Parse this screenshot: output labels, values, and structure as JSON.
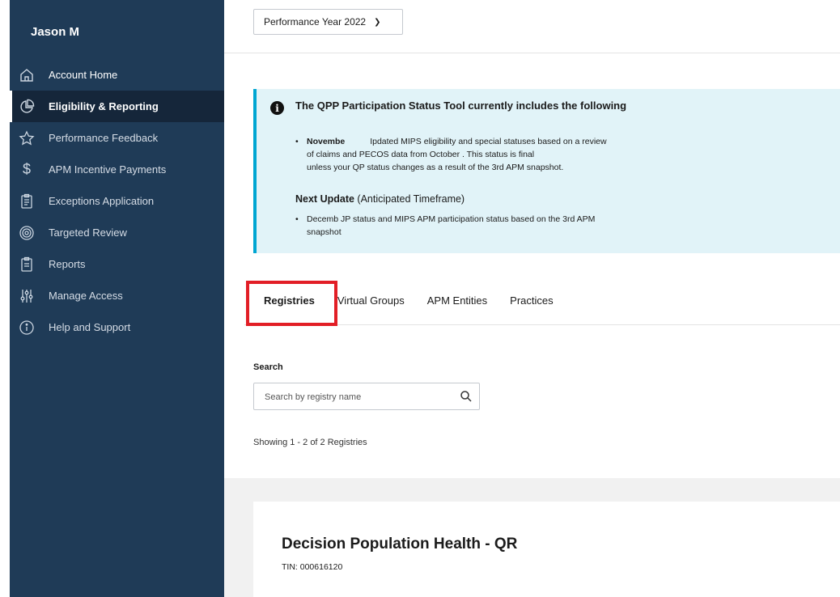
{
  "sidebar": {
    "user_name": "Jason M",
    "items": [
      {
        "label": "Account Home",
        "icon": "home-icon"
      },
      {
        "label": "Eligibility & Reporting",
        "icon": "pie-chart-icon"
      },
      {
        "label": "Performance Feedback",
        "icon": "star-icon"
      },
      {
        "label": "APM Incentive Payments",
        "icon": "dollar-icon"
      },
      {
        "label": "Exceptions Application",
        "icon": "clipboard-icon"
      },
      {
        "label": "Targeted Review",
        "icon": "target-icon"
      },
      {
        "label": "Reports",
        "icon": "clipboard-icon"
      },
      {
        "label": "Manage Access",
        "icon": "sliders-icon"
      },
      {
        "label": "Help and Support",
        "icon": "info-circle-icon"
      }
    ]
  },
  "header": {
    "performance_year": "Performance Year 2022"
  },
  "alert": {
    "title": "The QPP Participation Status Tool currently includes the following",
    "bullet1_bold": "Novembe",
    "bullet1_line1": "Ipdated MIPS eligibility and special statuses based on a review",
    "bullet1_line2": "of claims and PECOS data from October . This status is final",
    "bullet1_line3": "unless your QP status changes as a result of the 3rd APM snapshot.",
    "next_update_bold": "Next Update",
    "next_update_rest": " (Anticipated Timeframe)",
    "bullet2_line1": "Decemb JP status and MIPS APM participation status based on the 3rd APM",
    "bullet2_line2": "snapshot"
  },
  "tabs": [
    {
      "label": "Registries"
    },
    {
      "label": "Virtual Groups"
    },
    {
      "label": "APM Entities"
    },
    {
      "label": "Practices"
    }
  ],
  "search": {
    "label": "Search",
    "placeholder": "Search by registry name"
  },
  "results": {
    "showing_text": "Showing 1 - 2 of 2 Registries"
  },
  "card": {
    "title": "Decision Population Health - QR",
    "tin": "TIN: 000616120"
  },
  "colors": {
    "sidebar_bg": "#1f3b57",
    "sidebar_active_bg": "#15263a",
    "alert_bg": "#e1f3f8",
    "alert_border": "#00a6d2",
    "highlight_box": "#e21e26"
  }
}
